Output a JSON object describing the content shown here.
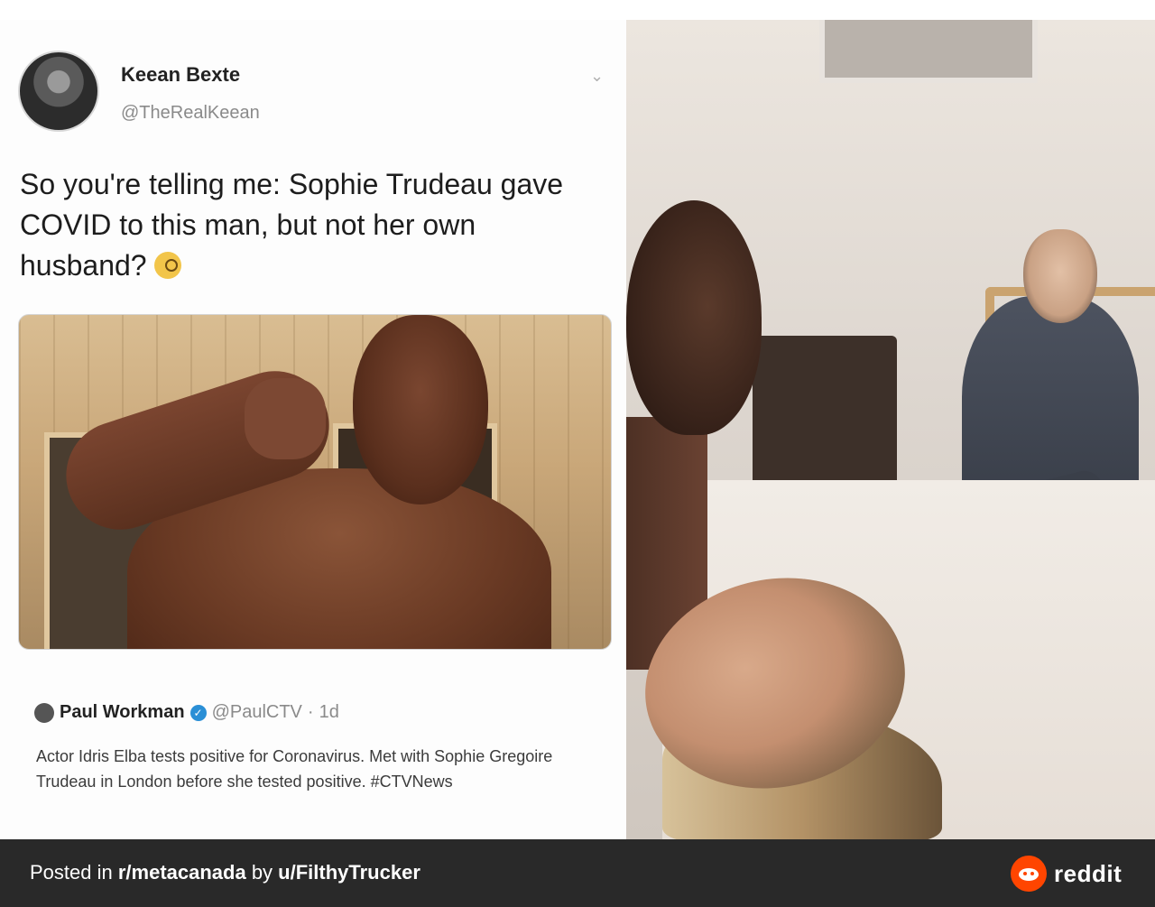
{
  "tweet": {
    "display_name": "Keean Bexte",
    "handle": "@TheRealKeean",
    "text": "So you're telling me: Sophie Trudeau gave COVID to this man, but not her own husband?",
    "emoji_icon": "monocle-face-icon"
  },
  "quoted_tweet": {
    "name": "Paul Workman",
    "handle": "@PaulCTV",
    "separator": "·",
    "age": "1d",
    "text": "Actor Idris Elba tests positive for Coronavirus. Met with Sophie Gregoire Trudeau in London before she tested positive. #CTVNews"
  },
  "footer": {
    "posted_in_prefix": "Posted in ",
    "subreddit": "r/metacanada",
    "by_text": " by ",
    "user": "u/FilthyTrucker",
    "brand": "reddit"
  },
  "colors": {
    "footer_bg": "#292929",
    "reddit_orange": "#ff4500",
    "verified_blue": "#2a8fd6"
  }
}
